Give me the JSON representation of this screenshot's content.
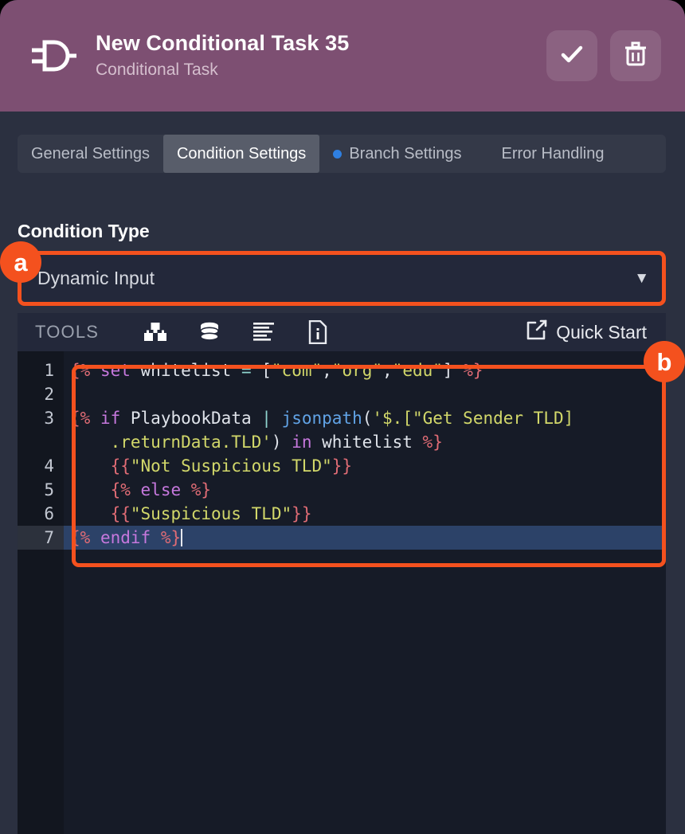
{
  "header": {
    "icon": "logic-gate-icon",
    "title": "New Conditional Task 35",
    "subtitle": "Conditional Task",
    "accept_icon": "check-icon",
    "delete_icon": "trash-icon",
    "background_color": "#7d4f72"
  },
  "tabs": [
    {
      "label": "General Settings",
      "active": false,
      "dot": false
    },
    {
      "label": "Condition Settings",
      "active": true,
      "dot": false
    },
    {
      "label": "Branch Settings",
      "active": false,
      "dot": true,
      "dot_color": "#2f7fe0"
    },
    {
      "label": "Error Handling",
      "active": false,
      "dot": false
    }
  ],
  "condition": {
    "label": "Condition Type",
    "selected": "Dynamic Input",
    "caret": "chevron-down-icon"
  },
  "tools": {
    "label": "TOOLS",
    "icons": [
      "blocks-icon",
      "database-icon",
      "text-lines-icon",
      "info-document-icon"
    ],
    "quick_start": {
      "label": "Quick Start",
      "icon": "external-link-icon"
    }
  },
  "editor": {
    "active_line": 7,
    "lines": [
      {
        "number": 1,
        "tokens": [
          {
            "t": "{%",
            "c": "d"
          },
          {
            "t": " ",
            "c": "n"
          },
          {
            "t": "set",
            "c": "k"
          },
          {
            "t": " whitelist ",
            "c": "n"
          },
          {
            "t": "=",
            "c": "o"
          },
          {
            "t": " [",
            "c": "n"
          },
          {
            "t": "\"com\"",
            "c": "s"
          },
          {
            "t": ",",
            "c": "n"
          },
          {
            "t": "\"org\"",
            "c": "s"
          },
          {
            "t": ",",
            "c": "n"
          },
          {
            "t": "\"edu\"",
            "c": "s"
          },
          {
            "t": "] ",
            "c": "n"
          },
          {
            "t": "%}",
            "c": "d"
          }
        ]
      },
      {
        "number": 2,
        "tokens": []
      },
      {
        "number": 3,
        "wrapped": true,
        "tokens": [
          {
            "t": "{%",
            "c": "d"
          },
          {
            "t": " ",
            "c": "n"
          },
          {
            "t": "if",
            "c": "k"
          },
          {
            "t": " PlaybookData ",
            "c": "n"
          },
          {
            "t": "|",
            "c": "o"
          },
          {
            "t": " ",
            "c": "n"
          },
          {
            "t": "jsonpath",
            "c": "f"
          },
          {
            "t": "(",
            "c": "n"
          },
          {
            "t": "'$.[\"Get Sender TLD]",
            "c": "s"
          },
          {
            "t": "\n    ",
            "c": "n"
          },
          {
            "t": ".returnData.TLD'",
            "c": "s"
          },
          {
            "t": ") ",
            "c": "n"
          },
          {
            "t": "in",
            "c": "k"
          },
          {
            "t": " whitelist ",
            "c": "n"
          },
          {
            "t": "%}",
            "c": "d"
          }
        ]
      },
      {
        "number": 4,
        "tokens": [
          {
            "t": "    ",
            "c": "n"
          },
          {
            "t": "{{",
            "c": "d"
          },
          {
            "t": "\"Not Suspicious TLD\"",
            "c": "s"
          },
          {
            "t": "}}",
            "c": "d"
          }
        ]
      },
      {
        "number": 5,
        "tokens": [
          {
            "t": "    ",
            "c": "n"
          },
          {
            "t": "{%",
            "c": "d"
          },
          {
            "t": " ",
            "c": "n"
          },
          {
            "t": "else",
            "c": "k"
          },
          {
            "t": " ",
            "c": "n"
          },
          {
            "t": "%}",
            "c": "d"
          }
        ]
      },
      {
        "number": 6,
        "tokens": [
          {
            "t": "    ",
            "c": "n"
          },
          {
            "t": "{{",
            "c": "d"
          },
          {
            "t": "\"Suspicious TLD\"",
            "c": "s"
          },
          {
            "t": "}}",
            "c": "d"
          }
        ]
      },
      {
        "number": 7,
        "active": true,
        "caret": true,
        "tokens": [
          {
            "t": "{%",
            "c": "d"
          },
          {
            "t": " ",
            "c": "n"
          },
          {
            "t": "endif",
            "c": "k"
          },
          {
            "t": " ",
            "c": "n"
          },
          {
            "t": "%}",
            "c": "d"
          }
        ]
      }
    ]
  },
  "annotations": [
    {
      "id": "a",
      "label": "a",
      "target": "condition-type-select",
      "color": "#f4511e"
    },
    {
      "id": "b",
      "label": "b",
      "target": "code-editor",
      "color": "#f4511e"
    }
  ]
}
